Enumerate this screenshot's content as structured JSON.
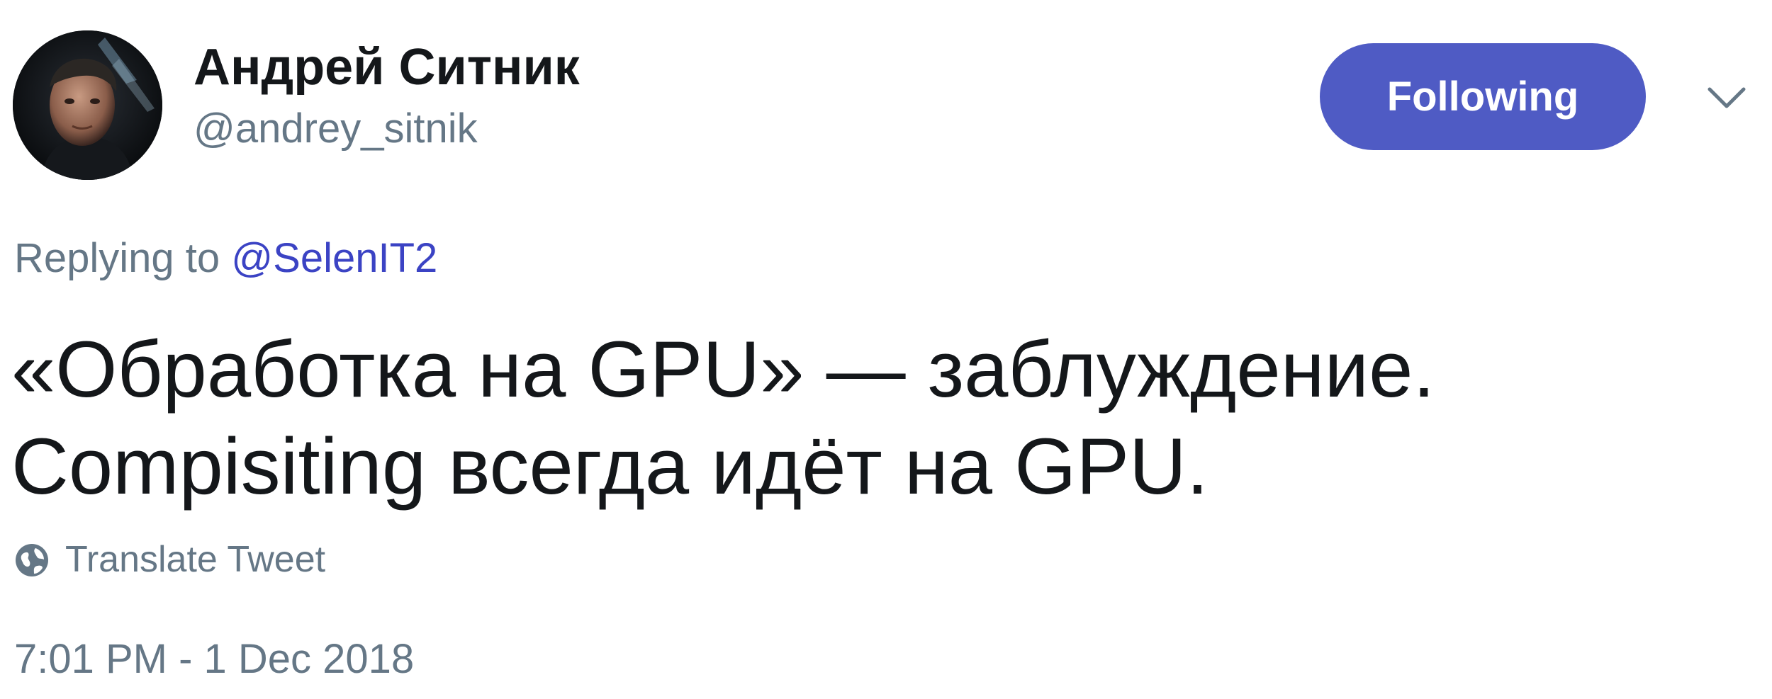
{
  "author": {
    "display_name": "Андрей Ситник",
    "handle": "@andrey_sitnik",
    "avatar_icon": "user-avatar"
  },
  "follow_button": {
    "label": "Following",
    "color": "#4f5bc4"
  },
  "menu": {
    "icon": "chevron-down-icon"
  },
  "reply": {
    "prefix": "Replying to",
    "mention": "@SelenIT2",
    "mention_color": "#3b43c4"
  },
  "tweet": {
    "text": "«Обработка на GPU» — заблуждение.\nCompisiting всегда идёт на GPU."
  },
  "translate": {
    "icon": "globe-icon",
    "label": "Translate Tweet"
  },
  "meta": {
    "timestamp": "7:01 PM - 1 Dec 2018"
  }
}
